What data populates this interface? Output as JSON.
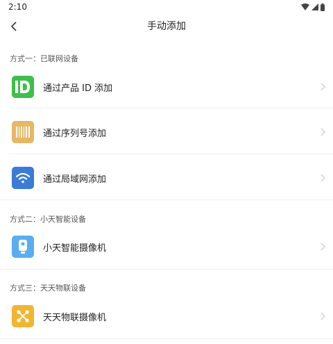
{
  "status": {
    "time": "2:10"
  },
  "header": {
    "title": "手动添加"
  },
  "sections": [
    {
      "heading": "方式一：已联网设备",
      "items": [
        {
          "label": "通过产品 ID 添加",
          "icon": "id-icon",
          "color": "#3dbf4a"
        },
        {
          "label": "通过序列号添加",
          "icon": "barcode-icon",
          "color": "#e8b765"
        },
        {
          "label": "通过局域网添加",
          "icon": "wifi-icon",
          "color": "#3a7bd5"
        }
      ]
    },
    {
      "heading": "方式二：小天智能设备",
      "items": [
        {
          "label": "小天智能摄像机",
          "icon": "camera-icon",
          "color": "#5aaef0"
        }
      ]
    },
    {
      "heading": "方式三：天天物联设备",
      "items": [
        {
          "label": "天天物联摄像机",
          "icon": "network-nodes-icon",
          "color": "#f2b533"
        }
      ]
    }
  ],
  "colors": {
    "chevron": "#cfcfcf",
    "divider": "#efefef"
  }
}
